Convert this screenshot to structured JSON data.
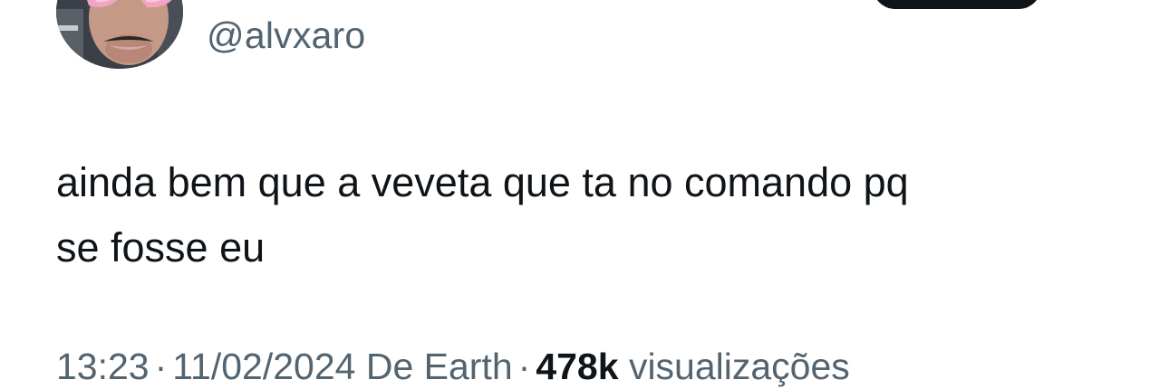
{
  "tweet": {
    "handle": "@alvxaro",
    "text": "ainda bem que a veveta que ta no comando pq\nse fosse eu",
    "time": "13:23",
    "separator": "·",
    "date": "11/02/2024",
    "source": "De Earth",
    "views_count": "478k",
    "views_label": "visualizações"
  },
  "colors": {
    "text": "#0f1419",
    "secondary": "#536471",
    "button": "#0f1419"
  }
}
